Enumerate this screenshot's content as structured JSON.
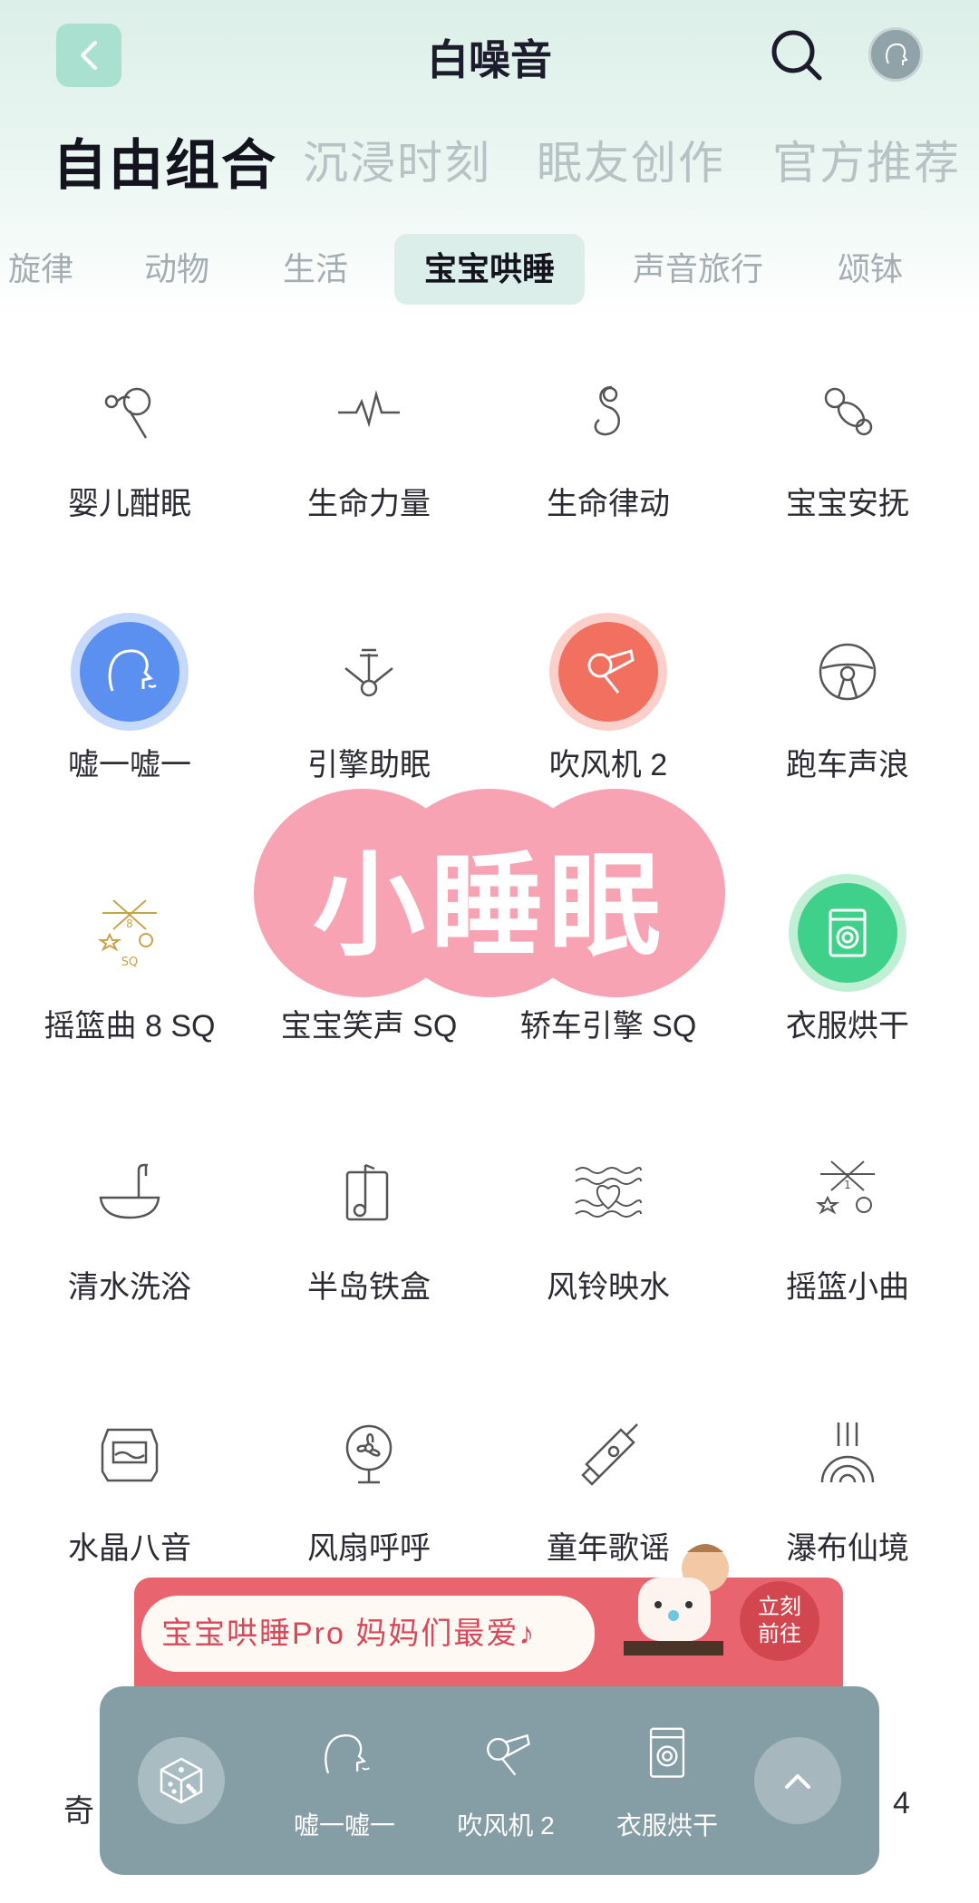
{
  "header": {
    "title": "白噪音",
    "back_icon": "chevron-left-icon",
    "search_icon": "search-icon",
    "avatar_icon": "avatar-icon"
  },
  "main_tabs": [
    {
      "label": "自由组合",
      "active": true
    },
    {
      "label": "沉浸时刻",
      "active": false
    },
    {
      "label": "眠友创作",
      "active": false
    },
    {
      "label": "官方推荐",
      "active": false
    }
  ],
  "sub_tabs": [
    {
      "label": "旋律",
      "active": false
    },
    {
      "label": "动物",
      "active": false
    },
    {
      "label": "生活",
      "active": false
    },
    {
      "label": "宝宝哄睡",
      "active": true
    },
    {
      "label": "声音旅行",
      "active": false
    },
    {
      "label": "颂钵",
      "active": false
    }
  ],
  "sounds": [
    {
      "label": "婴儿酣眠",
      "icon": "rattle-icon",
      "selected": false
    },
    {
      "label": "生命力量",
      "icon": "heartbeat-icon",
      "selected": false
    },
    {
      "label": "生命律动",
      "icon": "fetus-icon",
      "selected": false
    },
    {
      "label": "宝宝安抚",
      "icon": "pacifier-icon",
      "selected": false
    },
    {
      "label": "嘘一嘘一",
      "icon": "shushing-face-icon",
      "selected": true,
      "color": "#5b8ff0"
    },
    {
      "label": "引擎助眠",
      "icon": "engine-icon",
      "selected": false
    },
    {
      "label": "吹风机 2",
      "icon": "hair-dryer-icon",
      "selected": true,
      "color": "#f2705f"
    },
    {
      "label": "跑车声浪",
      "icon": "steering-wheel-icon",
      "selected": false
    },
    {
      "label": "摇篮曲 8 SQ",
      "icon": "crib-mobile-8-icon",
      "selected": false
    },
    {
      "label": "宝宝笑声 SQ",
      "icon": "baby-laugh-icon",
      "selected": false
    },
    {
      "label": "轿车引擎 SQ",
      "icon": "car-engine-icon",
      "selected": false
    },
    {
      "label": "衣服烘干",
      "icon": "washing-machine-icon",
      "selected": true,
      "color": "#3fd08a"
    },
    {
      "label": "清水洗浴",
      "icon": "bathtub-icon",
      "selected": false
    },
    {
      "label": "半岛铁盒",
      "icon": "music-box-icon",
      "selected": false
    },
    {
      "label": "风铃映水",
      "icon": "wind-chime-icon",
      "selected": false
    },
    {
      "label": "摇篮小曲",
      "icon": "crib-mobile-1-icon",
      "selected": false
    },
    {
      "label": "水晶八音",
      "icon": "crystal-box-icon",
      "selected": false
    },
    {
      "label": "风扇呼呼",
      "icon": "fan-icon",
      "selected": false
    },
    {
      "label": "童年歌谣",
      "icon": "water-gun-icon",
      "selected": false
    },
    {
      "label": "瀑布仙境",
      "icon": "waterfall-icon",
      "selected": false
    }
  ],
  "sticker": {
    "text": "小睡眠",
    "color": "#f7a3b4"
  },
  "banner": {
    "text": "宝宝哄睡Pro 妈妈们最爱♪",
    "cta_line1": "立刻",
    "cta_line2": "前往",
    "bg": "#e8646f"
  },
  "partial_labels": {
    "left": "奇",
    "right": "4"
  },
  "player": {
    "dice_icon": "dice-icon",
    "expand_icon": "chevron-up-icon",
    "mix": [
      {
        "label": "嘘一嘘一",
        "icon": "shushing-face-icon"
      },
      {
        "label": "吹风机 2",
        "icon": "hair-dryer-icon"
      },
      {
        "label": "衣服烘干",
        "icon": "washing-machine-icon"
      }
    ]
  },
  "colors": {
    "accent": "#a9e0cf",
    "active_tab_bg": "#dceee9",
    "player_bg": "#7d979e"
  }
}
